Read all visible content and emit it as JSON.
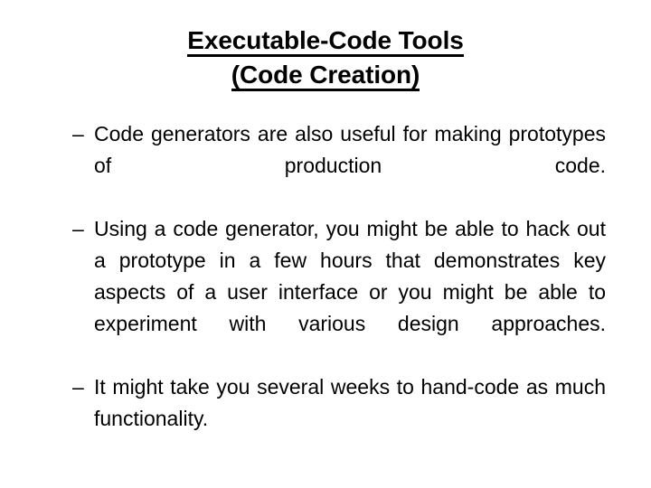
{
  "slide": {
    "background_color": "#ffffff",
    "text_color": "#000000",
    "title": {
      "line1": "Executable-Code Tools",
      "line2": "(Code Creation)"
    },
    "bullets": [
      {
        "marker": "–",
        "text": "Code generators are also useful for making prototypes of production code."
      },
      {
        "marker": "–",
        "text": "Using a code generator, you might be able to hack out a prototype in a few hours that demonstrates key aspects of a user interface or you might be able to experiment with various design approaches."
      },
      {
        "marker": "–",
        "text": "It might take you several weeks to hand-code as much functionality."
      }
    ]
  }
}
